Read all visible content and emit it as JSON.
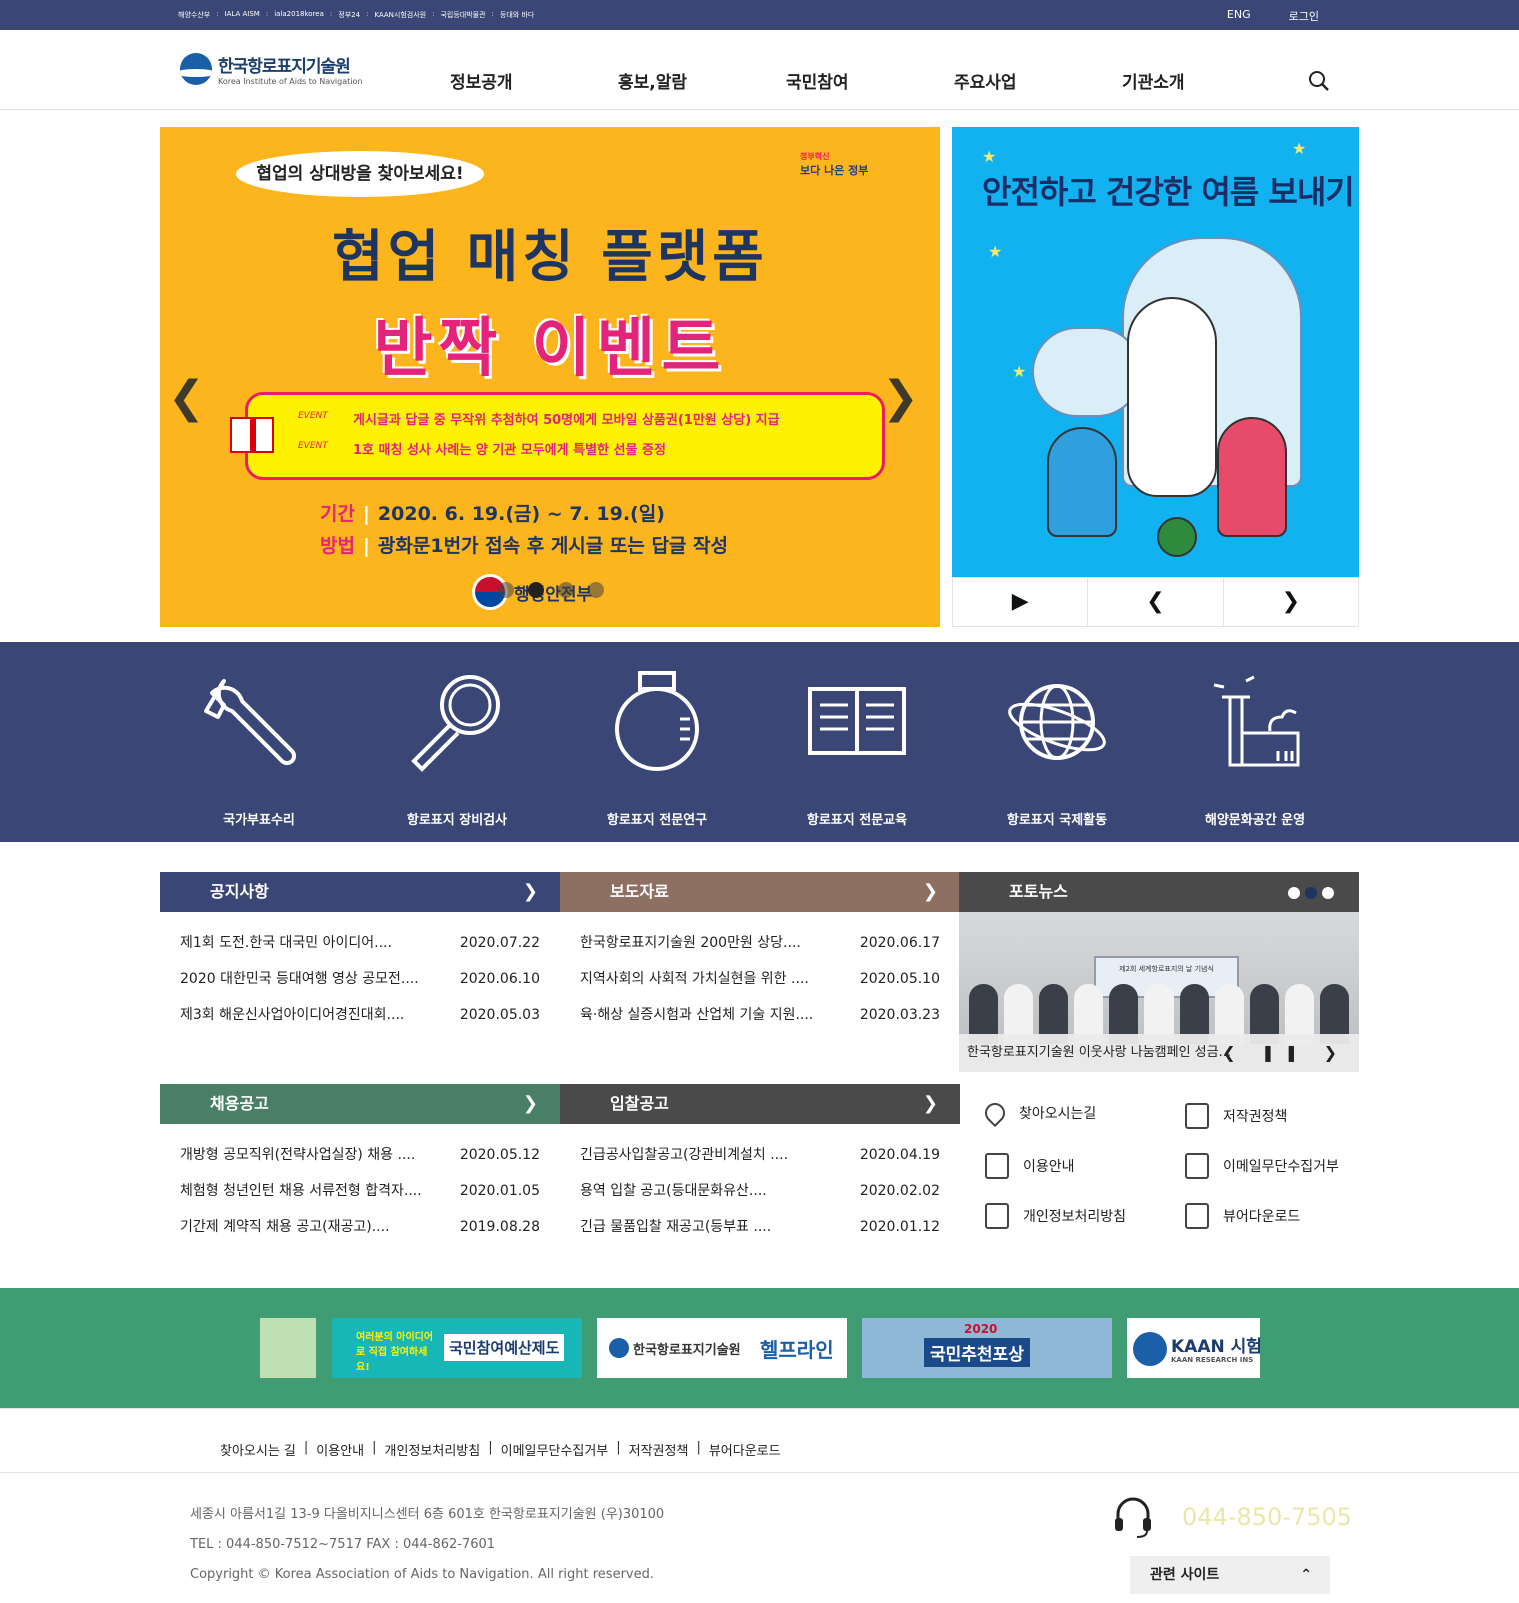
{
  "topbar": {
    "links": [
      "해양수산부",
      "IALA AISM",
      "iala2018korea",
      "정부24",
      "KAAN시험검사원",
      "국립등대박물관",
      "등대와 바다"
    ],
    "sep": ":",
    "eng": "ENG",
    "login": "로그인"
  },
  "header": {
    "logo_ko": "한국항로표지기술원",
    "logo_en": "Korea Institute of Aids to Navigation",
    "nav": [
      "정보공개",
      "홍보,알람",
      "국민참여",
      "주요사업",
      "기관소개"
    ]
  },
  "main_banner": {
    "bubble": "협업의 상대방을 찾아보세요!",
    "gov_small": "정부혁신",
    "gov_badge": "보다 나은 정부",
    "title": "협업 매칭 플랫폼",
    "event": "반짝 이벤트",
    "event_tag": "EVENT",
    "line1": "게시글과 답글 중 무작위 추첨하여 50명에게 모바일 상품권(1만원 상당) 지급",
    "line2": "1호 매칭 성사 사례는 양 기관 모두에게 특별한 선물 증정",
    "period_label": "기간",
    "period": "2020. 6. 19.(금) ~ 7. 19.(일)",
    "method_label": "방법",
    "method": "광화문1번가 접속 후 게시글 또는 답글 작성",
    "ministry": "행정안전부",
    "prev": "❮",
    "next": "❯"
  },
  "side_banner": {
    "title": "안전하고 건강한 여름 보내기",
    "play": "▶",
    "prev": "❮",
    "next": "❯"
  },
  "services": [
    "국가부표수리",
    "항로표지 장비검사",
    "항로표지 전문연구",
    "항로표지 전문교육",
    "항로표지 국제활동",
    "해양문화공간 운영"
  ],
  "boards": {
    "notice": {
      "title": "공지사항",
      "rows": [
        {
          "t": "제1회 도전.한국 대국민 아이디어....",
          "d": "2020.07.22"
        },
        {
          "t": "2020 대한민국 등대여행 영상 공모전....",
          "d": "2020.06.10"
        },
        {
          "t": "제3회 해운신사업아이디어경진대회....",
          "d": "2020.05.03"
        }
      ]
    },
    "press": {
      "title": "보도자료",
      "rows": [
        {
          "t": "한국항로표지기술원 200만원 상당....",
          "d": "2020.06.17"
        },
        {
          "t": "지역사회의 사회적 가치실현을 위한 ....",
          "d": "2020.05.10"
        },
        {
          "t": "육·해상 실증시험과 산업체 기술 지원....",
          "d": "2020.03.23"
        }
      ]
    },
    "recruit": {
      "title": "채용공고",
      "rows": [
        {
          "t": "개방형 공모직위(전략사업실장) 채용 ....",
          "d": "2020.05.12"
        },
        {
          "t": "체험형 청년인턴 채용 서류전형 합격자....",
          "d": "2020.01.05"
        },
        {
          "t": "기간제 계약직 채용 공고(재공고)....",
          "d": "2019.08.28"
        }
      ]
    },
    "bid": {
      "title": "입찰공고",
      "rows": [
        {
          "t": "긴급공사입찰공고(강관비계설치 ....",
          "d": "2020.04.19"
        },
        {
          "t": "용역 입찰 공고(등대문화유산....",
          "d": "2020.02.02"
        },
        {
          "t": "긴급 물품입찰 재공고(등부표 ....",
          "d": "2020.01.12"
        }
      ]
    },
    "more": "❯"
  },
  "photo_news": {
    "title": "포토뉴스",
    "screen_text": "제2회 세계항로표지의 날 기념식",
    "caption": "한국항로표지기술원 이웃사랑 나눔캠페인 성금...",
    "controls": "❮ ❚❚ ❯"
  },
  "quick_links": [
    "찾아오시는길",
    "저작권정책",
    "이용안내",
    "이메일무단수집거부",
    "개인정보처리방침",
    "뷰어다운로드"
  ],
  "banners": {
    "b2_small": "여러분의 아이디어로 직접 참여하세요!",
    "b2_big": "국민참여예산제도",
    "b3_ko": "한국항로표지기술원",
    "b3_big": "헬프라인",
    "b4_year": "2020",
    "b4_big": "국민추천포상",
    "b5": "KAAN 시험",
    "b5_sub": "KAAN RESEARCH INS"
  },
  "footer": {
    "links": [
      "찾아오시는 길",
      "이용안내",
      "개인정보처리방침",
      "이메일무단수집거부",
      "저작권정책",
      "뷰어다운로드"
    ],
    "sep": "|",
    "address": "세종시 아름서1길 13-9 다올비지니스센터 6층 601호 한국항로표지기술원 (우)30100",
    "tel": "TEL : 044-850-7512~7517 FAX : 044-862-7601",
    "copyright": "Copyright © Korea Association of Aids to Navigation. All right reserved.",
    "phone": "044-850-7505",
    "related": "관련 사이트",
    "related_icon": "⌃"
  }
}
